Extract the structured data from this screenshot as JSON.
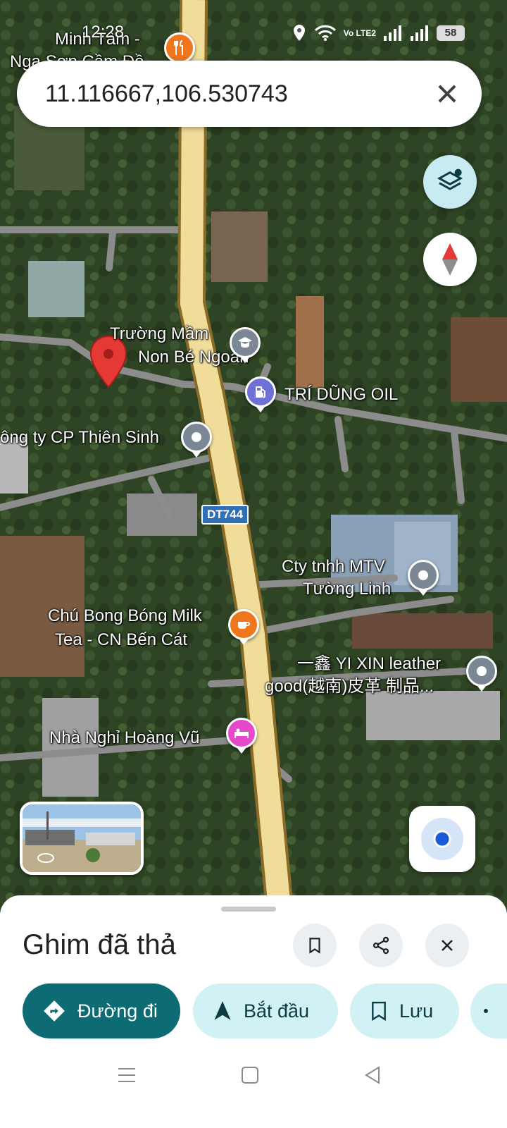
{
  "status_bar": {
    "time": "12:28",
    "network": "Vo LTE2",
    "battery": "58"
  },
  "search": {
    "query": "11.116667,106.530743"
  },
  "map": {
    "road_shield": "DT744",
    "places": [
      {
        "id": "minh-tam",
        "label": "Minh Tâm -\nNga Sơn Cầm Đồ",
        "type": "restaurant"
      },
      {
        "id": "truong-mam-non",
        "label": "Trường Mầm\nNon Bé Ngoan",
        "type": "school"
      },
      {
        "id": "tri-dung-oil",
        "label": "TRÍ DŨNG OIL",
        "type": "gas-station"
      },
      {
        "id": "thien-sinh",
        "label": "Công ty CP Thiên Sinh",
        "type": "place"
      },
      {
        "id": "tuong-linh",
        "label": "Cty tnhh MTV\nTường Linh",
        "type": "place"
      },
      {
        "id": "bong-bong",
        "label": "Chú Bong Bóng Milk\nTea - CN Bến Cát",
        "type": "cafe"
      },
      {
        "id": "yi-xin",
        "label": "一鑫 YI XIN leather\ngood(越南)皮革 制品...",
        "type": "place"
      },
      {
        "id": "hoang-vu",
        "label": "Nhà Nghỉ Hoàng Vũ",
        "type": "lodging"
      }
    ]
  },
  "sheet": {
    "title": "Ghim đã thả",
    "actions": [
      {
        "label": "Đường đi",
        "icon": "directions-icon"
      },
      {
        "label": "Bắt đầu",
        "icon": "navigation-arrow-icon"
      },
      {
        "label": "Lưu",
        "icon": "bookmark-icon"
      }
    ]
  },
  "colors": {
    "primary": "#0c6b73",
    "chip_secondary": "#d2f1f4",
    "pin_red": "#e53935"
  }
}
